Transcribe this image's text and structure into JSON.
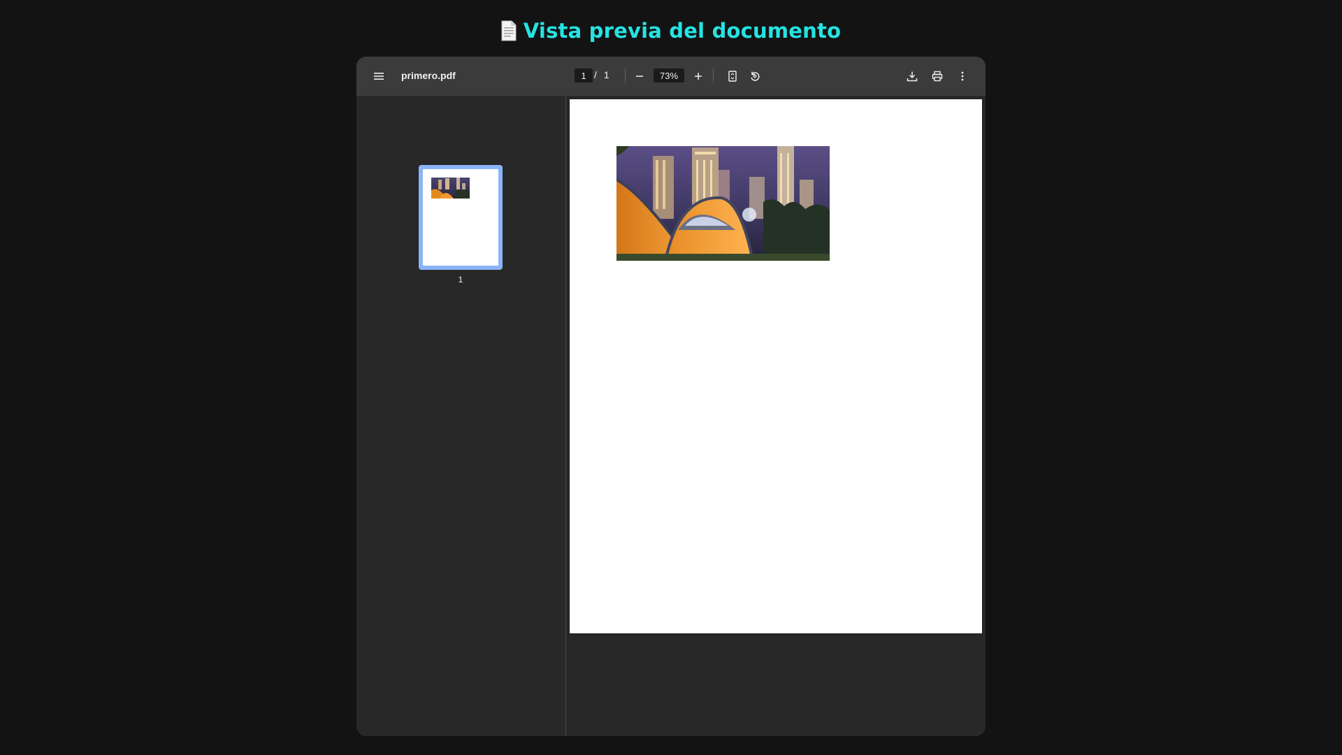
{
  "header": {
    "icon": "document-emoji-icon",
    "title": "Vista previa del documento",
    "title_color": "#26e3e3"
  },
  "viewer": {
    "toolbar": {
      "menu_icon": "hamburger-menu-icon",
      "file_name": "primero.pdf",
      "current_page": "1",
      "page_separator": "/",
      "total_pages": "1",
      "zoom_out_icon": "minus-icon",
      "zoom_value": "73%",
      "zoom_in_icon": "plus-icon",
      "fit_icon": "fit-to-page-icon",
      "rotate_icon": "rotate-counterclockwise-icon",
      "download_icon": "download-icon",
      "print_icon": "print-icon",
      "more_icon": "more-vertical-icon"
    },
    "sidebar": {
      "thumbnails": [
        {
          "label": "1",
          "selected": true
        }
      ],
      "selected_border_color": "#8ab4f8"
    },
    "document": {
      "image_description_icon": "city-camping-photo"
    }
  }
}
